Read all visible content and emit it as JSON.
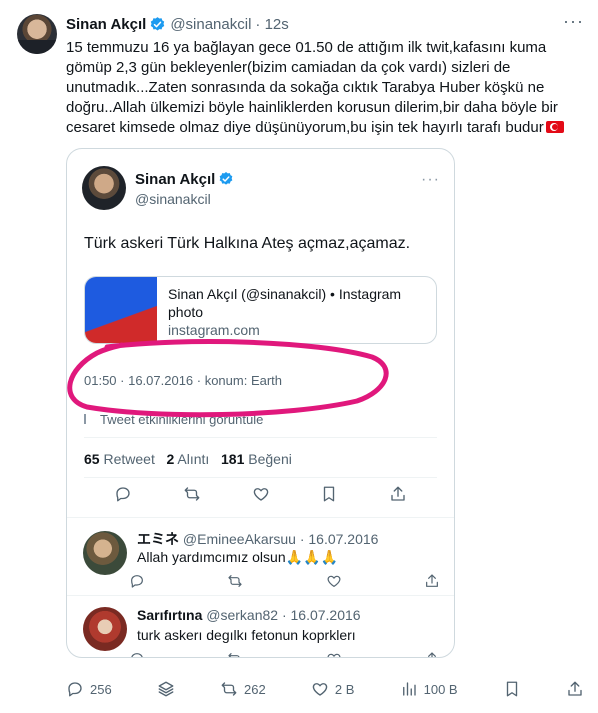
{
  "post": {
    "author_name": "Sinan Akçıl",
    "author_handle": "@sinanakcil",
    "time_ago": "· 12s",
    "text": "15 temmuzu 16 ya bağlayan gece 01.50 de attığım ilk twit,kafasını kuma gömüp 2,3 gün bekleyenler(bizim camiadan da çok vardı) sizleri de unutmadık...Zaten sonrasında da sokağa cıktık Tarabya Huber köşkü ne doğru..Allah ülkemizi böyle hainliklerden korusun dilerim,bir daha böyle bir cesaret kimsede olmaz diye düşünüyorum,bu işin tek hayırlı tarafı budur",
    "more_icon": "ellipsis-icon"
  },
  "screenshot": {
    "author_name": "Sinan Akçıl",
    "author_handle": "@sinanakcil",
    "text": "Türk askeri Türk Halkına Ateş açmaz,açamaz.",
    "card_title": "Sinan Akçıl (@sinanakcil) • Instagram photo",
    "card_domain": "instagram.com",
    "meta": "01:50 · 16.07.2016 · konum: Earth",
    "engagements_link": "Tweet etkinliklerini görüntüle",
    "stats": {
      "retweets_value": "65",
      "retweets_label": "Retweet",
      "quotes_value": "2",
      "quotes_label": "Alıntı",
      "likes_value": "181",
      "likes_label": "Beğeni"
    },
    "replies": [
      {
        "name": "エミネ",
        "handle_date": "@EmineeAkarsuu · 16.07.2016",
        "text": "Allah yardımcımız olsun🙏🙏🙏"
      },
      {
        "name": "Sarıfırtına",
        "handle_date": "@serkan82 · 16.07.2016",
        "text": "turk askerı degılkı fetonun koprklerı"
      }
    ]
  },
  "actions": {
    "replies": "256",
    "retweets": "262",
    "likes": "2 B",
    "views": "100 B"
  },
  "colors": {
    "verified": "#1d9bf0",
    "annotation": "#e0187c",
    "muted_text": "#536471"
  }
}
